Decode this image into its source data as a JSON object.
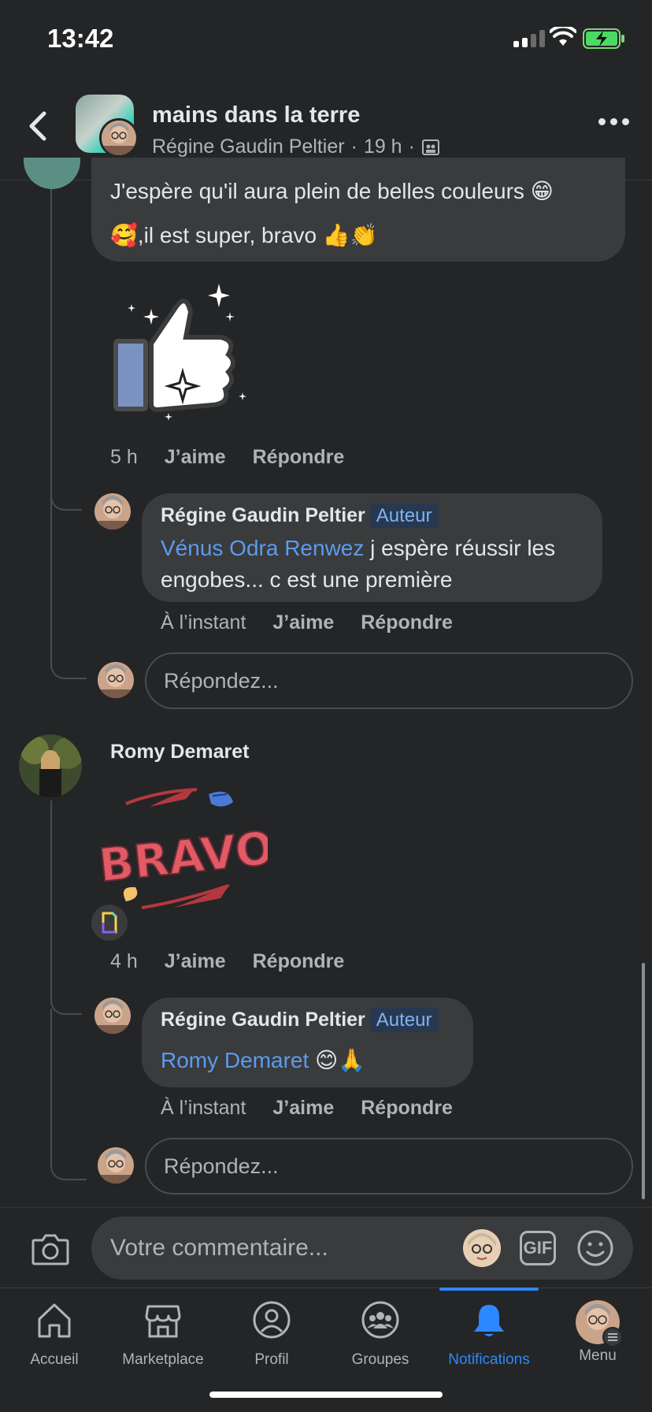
{
  "status_bar": {
    "time": "13:42"
  },
  "header": {
    "title": "mains dans la terre",
    "author": "Régine Gaudin Peltier",
    "time": "19 h"
  },
  "comment1": {
    "line1": "J'espère qu'il aura plein de belles couleurs 😁",
    "line2": "🥰,il est super, bravo 👍👏",
    "time": "5 h",
    "like": "J’aime",
    "reply": "Répondre"
  },
  "reply1": {
    "author": "Régine Gaudin Peltier",
    "badge": "Auteur",
    "mention": "Vénus Odra Renwez",
    "text_a": " j espère réussir les",
    "text_b": "engobes... c est une première",
    "time": "À l’instant",
    "like": "J’aime",
    "reply": "Répondre"
  },
  "reply_input1": {
    "placeholder": "Répondez..."
  },
  "comment2": {
    "author": "Romy Demaret",
    "sticker_text": "BRAVO",
    "time": "4 h",
    "like": "J’aime",
    "reply": "Répondre"
  },
  "reply2": {
    "author": "Régine Gaudin Peltier",
    "badge": "Auteur",
    "mention": "Romy Demaret",
    "text": " 😊🙏",
    "time": "À l’instant",
    "like": "J’aime",
    "reply": "Répondre"
  },
  "reply_input2": {
    "placeholder": "Répondez..."
  },
  "composer": {
    "placeholder": "Votre commentaire...",
    "gif_label": "GIF"
  },
  "tabs": [
    {
      "label": "Accueil",
      "icon": "home-icon"
    },
    {
      "label": "Marketplace",
      "icon": "store-icon"
    },
    {
      "label": "Profil",
      "icon": "profile-icon"
    },
    {
      "label": "Groupes",
      "icon": "groups-icon"
    },
    {
      "label": "Notifications",
      "icon": "bell-icon",
      "active": true
    },
    {
      "label": "Menu",
      "icon": "menu-icon"
    }
  ],
  "colors": {
    "background": "#242526",
    "bubble": "#3a3b3c",
    "accent": "#2d88ff",
    "mention": "#5b9bf0"
  }
}
